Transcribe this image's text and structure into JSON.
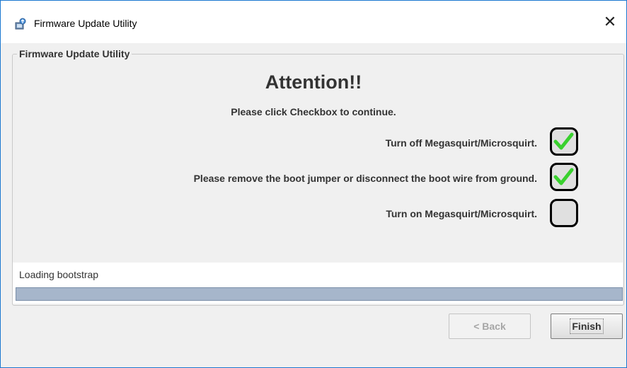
{
  "window": {
    "title": "Firmware Update Utility",
    "close_glyph": "✕",
    "app_icon": "installer-icon"
  },
  "group": {
    "title": "Firmware Update Utility"
  },
  "content": {
    "heading": "Attention!!",
    "subheading": "Please click Checkbox to continue.",
    "steps": [
      {
        "label": "Turn off Megasquirt/Microsquirt.",
        "checked": true
      },
      {
        "label": "Please remove the boot jumper or disconnect the boot wire from ground.",
        "checked": true
      },
      {
        "label": "Turn on Megasquirt/Microsquirt.",
        "checked": false
      }
    ]
  },
  "status": {
    "text": "Loading bootstrap",
    "progress": 1.0
  },
  "buttons": {
    "back_label": "< Back",
    "back_enabled": false,
    "finish_label": "Finish"
  },
  "colors": {
    "check_green": "#39d12e",
    "progress_fill": "#a6b6cb",
    "window_border": "#1b78d0"
  }
}
